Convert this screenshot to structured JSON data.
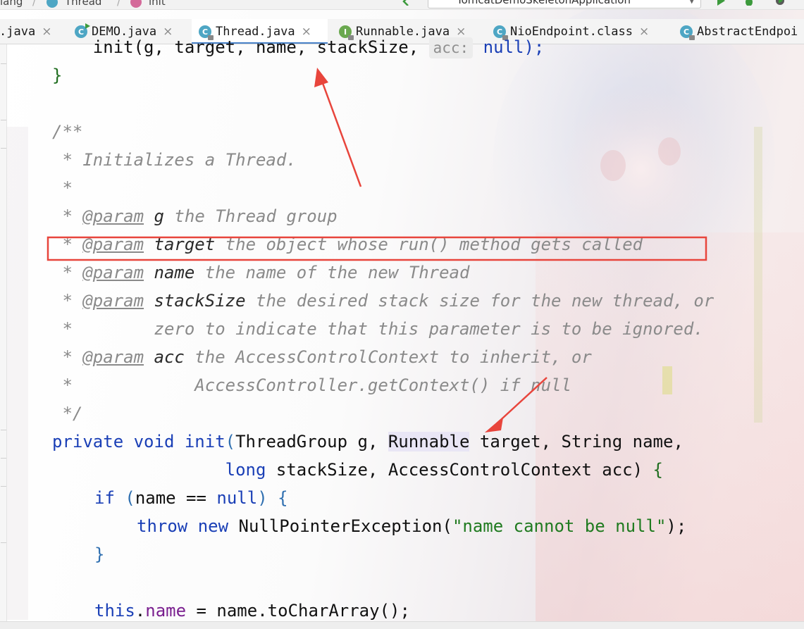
{
  "breadcrumb": [
    {
      "label": "lang"
    },
    {
      "label": "Thread"
    },
    {
      "label": "init"
    }
  ],
  "run_config": {
    "label": "TomcatDemoSkeletonApplication"
  },
  "tabs": [
    {
      "label": ".java",
      "icon": "none",
      "active": false
    },
    {
      "label": "DEMO.java",
      "icon": "class-runnable-icon",
      "active": false
    },
    {
      "label": "Thread.java",
      "icon": "class-icon",
      "active": true
    },
    {
      "label": "Runnable.java",
      "icon": "interface-icon",
      "active": false
    },
    {
      "label": "NioEndpoint.class",
      "icon": "class-icon",
      "active": false
    },
    {
      "label": "AbstractEndpoi",
      "icon": "class-icon",
      "active": false
    }
  ],
  "tab_close_glyph": "×",
  "code": {
    "l1": {
      "a": "    init(g, target, name, stackSize, ",
      "hint": "acc:",
      "b": " null);"
    },
    "l2": "}",
    "l4": "/**",
    "l5": " * Initializes a Thread.",
    "l6": " *",
    "l7": {
      "star": " * ",
      "tag": "@param",
      "name": " g",
      "text": " the Thread group"
    },
    "l8": {
      "star": " * ",
      "tag": "@param",
      "name": " target",
      "text": " the object whose run() method gets called"
    },
    "l9": {
      "star": " * ",
      "tag": "@param",
      "name": " name",
      "text": " the name of the new Thread"
    },
    "l10": {
      "star": " * ",
      "tag": "@param",
      "name": " stackSize",
      "text": " the desired stack size for the new thread, or"
    },
    "l11": " *        zero to indicate that this parameter is to be ignored.",
    "l12": {
      "star": " * ",
      "tag": "@param",
      "name": " acc",
      "text": " the AccessControlContext to inherit, or"
    },
    "l13": " *            AccessController.getContext() if null",
    "l14": " */",
    "l15": {
      "kw1": "private",
      "kw2": "void",
      "fn": "init",
      "p1": "ThreadGroup g, ",
      "hl": "Runnable",
      "p2": " target, String name,"
    },
    "l16": {
      "indent": "                 ",
      "kw": "long",
      "rest": " stackSize, AccessControlContext acc) ",
      "brace": "{"
    },
    "l17": {
      "kw": "if",
      "cond": "name == ",
      "nul": "null",
      "brace": "{"
    },
    "l18": {
      "kw1": "throw",
      "kw2": "new",
      "cls": " NullPointerException(",
      "str": "\"name cannot be null\"",
      "end": ");"
    },
    "l19": "}",
    "l21": {
      "kw": "this",
      "field": "name",
      "rest": " = name.toCharArray();"
    }
  },
  "colors": {
    "keyword": "#1a3fb6",
    "comment": "#8a8a8a",
    "string": "#1f7a1f",
    "annotation_red": "#e8453c",
    "tab_underline": "#4a83c9"
  }
}
